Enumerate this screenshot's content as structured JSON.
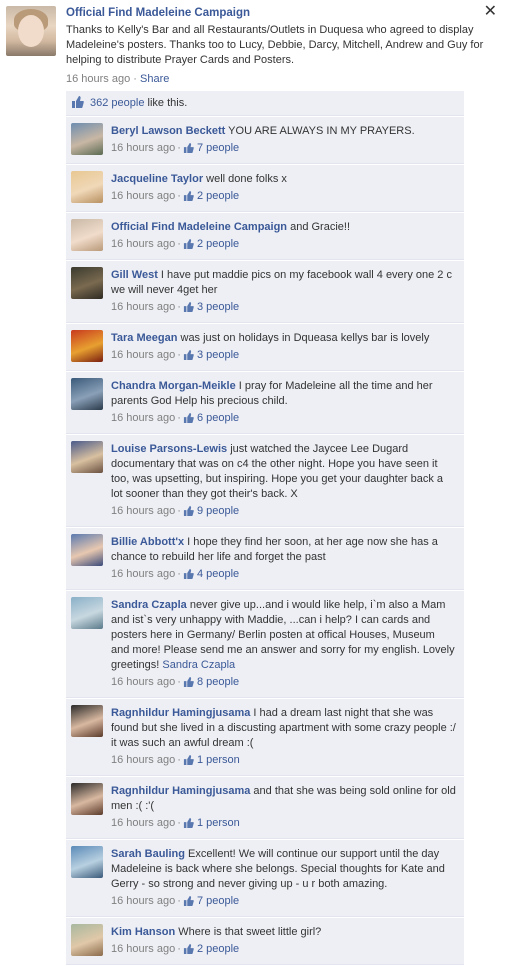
{
  "close_label": "✕",
  "post": {
    "author": "Official Find Madeleine Campaign",
    "text": "Thanks to Kelly's Bar and all Restaurants/Outlets in Duquesa who agreed to display Madeleine's posters. Thanks too to Lucy, Debbie, Darcy, Mitchell, Andrew and Guy for helping to distribute Prayer Cards and Posters.",
    "time": "16 hours ago",
    "sep": " · ",
    "share": "Share",
    "likes_count": "362 people",
    "likes_suffix": " like this."
  },
  "comments": [
    {
      "name": "Beryl Lawson Beckett",
      "text": " YOU ARE ALWAYS IN MY PRAYERS.",
      "time": "16 hours ago",
      "likes": "7 people",
      "avatar": [
        "#6d8db0",
        "#c8b7a4",
        "#5a6a52"
      ]
    },
    {
      "name": "Jacqueline Taylor",
      "text": " well done folks x",
      "time": "16 hours ago",
      "likes": "2 people",
      "avatar": [
        "#e8c892",
        "#f0d8b8",
        "#b89060"
      ]
    },
    {
      "name": "Official Find Madeleine Campaign",
      "text": " and Gracie!!",
      "time": "16 hours ago",
      "likes": "2 people",
      "avatar": [
        "#c9b9a6",
        "#f1dccb",
        "#b99a79"
      ]
    },
    {
      "name": "Gill West",
      "text": " I have put maddie pics on my facebook wall 4 every one 2 c we will never 4get her",
      "time": "16 hours ago",
      "likes": "3 people",
      "avatar": [
        "#3a3a2e",
        "#7a6a50",
        "#2e2a22"
      ]
    },
    {
      "name": "Tara Meegan",
      "text": " was just on holidays in Dqueasa kellys bar is lovely",
      "time": "16 hours ago",
      "likes": "3 people",
      "avatar": [
        "#c83a1e",
        "#e8a030",
        "#7a1e10"
      ]
    },
    {
      "name": "Chandra Morgan-Meikle",
      "text": " I pray for Madeleine all the time and her parents God Help his precious child.",
      "time": "16 hours ago",
      "likes": "6 people",
      "avatar": [
        "#3a5a7a",
        "#8aa0b8",
        "#2a3a4a"
      ]
    },
    {
      "name": "Louise Parsons-Lewis",
      "text": " just watched the Jaycee Lee Dugard documentary that was on c4 the other night. Hope you have seen it too, was upsetting, but inspiring. Hope you get your daughter back a lot sooner than they got their's back. X",
      "time": "16 hours ago",
      "likes": "9 people",
      "avatar": [
        "#4a5a8a",
        "#d8c0a0",
        "#6a5040"
      ]
    },
    {
      "name": "Billie Abbott'x",
      "text": " I hope they find her soon, at her age now she has a chance to rebuild her life and forget the past",
      "time": "16 hours ago",
      "likes": "4 people",
      "avatar": [
        "#5a7ab0",
        "#e8c8b0",
        "#3a4a7a"
      ]
    },
    {
      "name": "Sandra Czapla",
      "text": " never give up...and i would like help, i`m also a Mam and ist`s very unhappy with Maddie, ...can i help? I can cards and posters here in Germany/ Berlin posten at offical Houses, Museum and more! Please send me an answer and sorry for my english. Lovely greetings! ",
      "tail": "Sandra Czapla",
      "time": "16 hours ago",
      "likes": "8 people",
      "avatar": [
        "#8ab0c8",
        "#c8d8e0",
        "#5a7a8a"
      ]
    },
    {
      "name": "Ragnhildur Hamingjusama",
      "text": " I had a dream last night that she was found but she lived in a discusting apartment with some crazy people :/ it was such an awful dream :(",
      "time": "16 hours ago",
      "likes": "1 person",
      "avatar": [
        "#2a2a2a",
        "#d8b8a0",
        "#5a3a2a"
      ]
    },
    {
      "name": "Ragnhildur Hamingjusama",
      "text": " and that she was being sold online for old men :( :'(",
      "time": "16 hours ago",
      "likes": "1 person",
      "avatar": [
        "#2a2a2a",
        "#d8b8a0",
        "#5a3a2a"
      ]
    },
    {
      "name": "Sarah Bauling",
      "text": " Excellent! We will continue our support until the day Madeleine is back where she belongs. Special thoughts for Kate and Gerry - so strong and never giving up - u r both amazing.",
      "time": "16 hours ago",
      "likes": "7 people",
      "avatar": [
        "#5a8ab8",
        "#b8d0e0",
        "#3a5a7a"
      ]
    },
    {
      "name": "Kim Hanson",
      "text": " Where is that sweet little girl?",
      "time": "16 hours ago",
      "likes": "2 people",
      "avatar": [
        "#a8b8a0",
        "#e0c8a8",
        "#8a6a4a"
      ]
    }
  ]
}
